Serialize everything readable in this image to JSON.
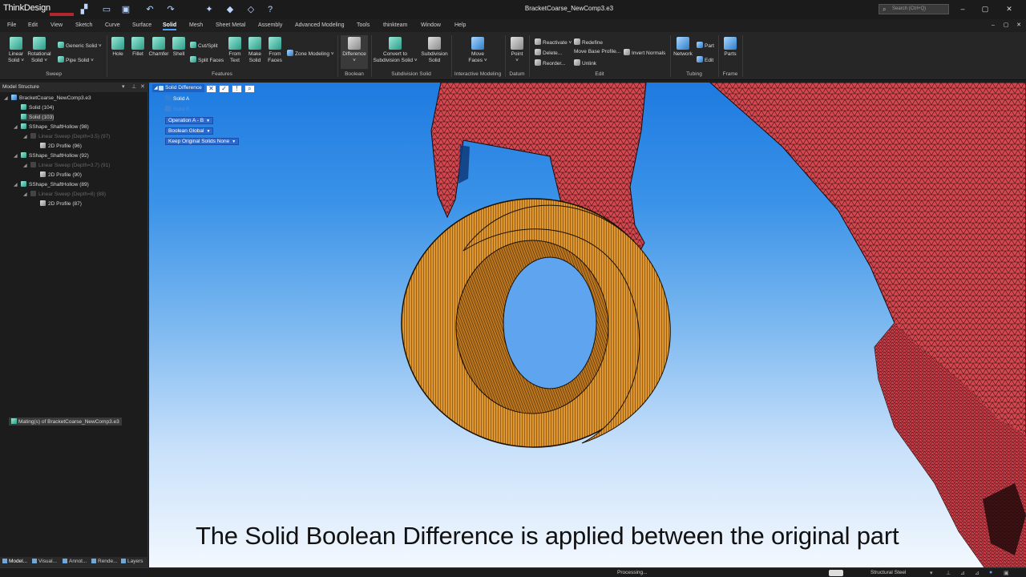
{
  "app": {
    "logo": "ThinkDesign",
    "document_title": "BracketCoarse_NewComp3.e3",
    "search_placeholder": "Search (Ctrl+Q)"
  },
  "menu": [
    "File",
    "Edit",
    "View",
    "Sketch",
    "Curve",
    "Surface",
    "Solid",
    "Mesh",
    "Sheet Metal",
    "Assembly",
    "Advanced Modeling",
    "Tools",
    "thinkteam",
    "Window",
    "Help"
  ],
  "menu_active": "Solid",
  "ribbon": {
    "sweep": {
      "linear_solid": [
        "Linear",
        "Solid ˅"
      ],
      "rotational_solid": [
        "Rotational",
        "Solid ˅"
      ],
      "generic_solid": "Generic Solid ˅",
      "pipe_solid": "Pipe Solid ˅",
      "group": "Sweep"
    },
    "features": {
      "hole": "Hole",
      "fillet": "Fillet",
      "chamfer": "Chamfer",
      "shell": "Shell",
      "cut_split": "Cut/Split",
      "split_faces": "Split Faces",
      "from_text": [
        "From",
        "Text"
      ],
      "make_solid": [
        "Make",
        "Solid"
      ],
      "from_faces": [
        "From",
        "Faces"
      ],
      "zone_modeling": "Zone Modeling ˅",
      "group": "Features"
    },
    "boolean": {
      "difference": "Difference",
      "group": "Boolean"
    },
    "subdivision": {
      "convert": [
        "Convert to",
        "Subdivision Solid ˅"
      ],
      "subdivision_solid": [
        "Subdivision",
        "Solid"
      ],
      "group": "Subdivision Solid"
    },
    "interactive": {
      "move_faces": [
        "Move",
        "Faces ˅"
      ],
      "group": "Interactive Modeling"
    },
    "datum": {
      "point": "Point",
      "group": "Datum"
    },
    "edit": {
      "reactivate": "Reactivate ˅",
      "delete": "Delete...",
      "reorder": "Reorder...",
      "redefine": "Redefine",
      "move_base_profile": "Move Base Profile...",
      "unlink": "Unlink",
      "invert_normals": "Invert Normals",
      "group": "Edit"
    },
    "tubing": {
      "network": "Network",
      "part": "Part",
      "edit": "Edit",
      "group": "Tubing"
    },
    "frame": {
      "parts": "Parts",
      "group": "Frame"
    }
  },
  "model_structure": {
    "title": "Model Structure",
    "nodes": [
      {
        "label": "BracketCoarse_NewComp3.e3",
        "icon": "assembly-icon",
        "dim": false,
        "selected": false
      },
      {
        "label": "Solid (104)",
        "icon": "solid-icon",
        "dim": false,
        "selected": false
      },
      {
        "label": "Solid (103)",
        "icon": "solid-icon",
        "dim": false,
        "selected": true
      },
      {
        "label": "SShape_ShaftHollow (98)",
        "icon": "solid-icon",
        "dim": false,
        "selected": false
      },
      {
        "label": "Linear Sweep (Depth=3.5) (97)",
        "icon": "sweep-icon",
        "dim": true,
        "selected": false
      },
      {
        "label": "2D Profile (96)",
        "icon": "profile-icon",
        "dim": false,
        "selected": false
      },
      {
        "label": "SShape_ShaftHollow (92)",
        "icon": "solid-icon",
        "dim": false,
        "selected": false
      },
      {
        "label": "Linear Sweep (Depth=3.7) (91)",
        "icon": "sweep-icon",
        "dim": true,
        "selected": false
      },
      {
        "label": "2D Profile (90)",
        "icon": "profile-icon",
        "dim": false,
        "selected": false
      },
      {
        "label": "SShape_ShaftHollow (89)",
        "icon": "solid-icon",
        "dim": false,
        "selected": false
      },
      {
        "label": "Linear Sweep (Depth=8) (88)",
        "icon": "sweep-icon",
        "dim": true,
        "selected": false
      },
      {
        "label": "2D Profile (87)",
        "icon": "profile-icon",
        "dim": false,
        "selected": false
      }
    ],
    "mating": "Mating(s) of BracketCoarse_NewComp3.e3",
    "tabs": [
      "Model...",
      "Visual...",
      "Annot...",
      "Rende...",
      "Layers"
    ]
  },
  "boolean_panel": {
    "title": "Solid Difference",
    "solid_a": "Solid A",
    "solid_b": "Solid B",
    "operation": "Operation A - B",
    "boolean": "Boolean Global",
    "keep": "Keep Original Solids None"
  },
  "caption": "The Solid Boolean Difference is applied between the original part",
  "status": {
    "text": "Processing...",
    "material": "Structural Steel"
  },
  "colors": {
    "mesh_red": "#d4474f",
    "ring_orange": "#e2962f",
    "accent_blue": "#1a63c4"
  }
}
